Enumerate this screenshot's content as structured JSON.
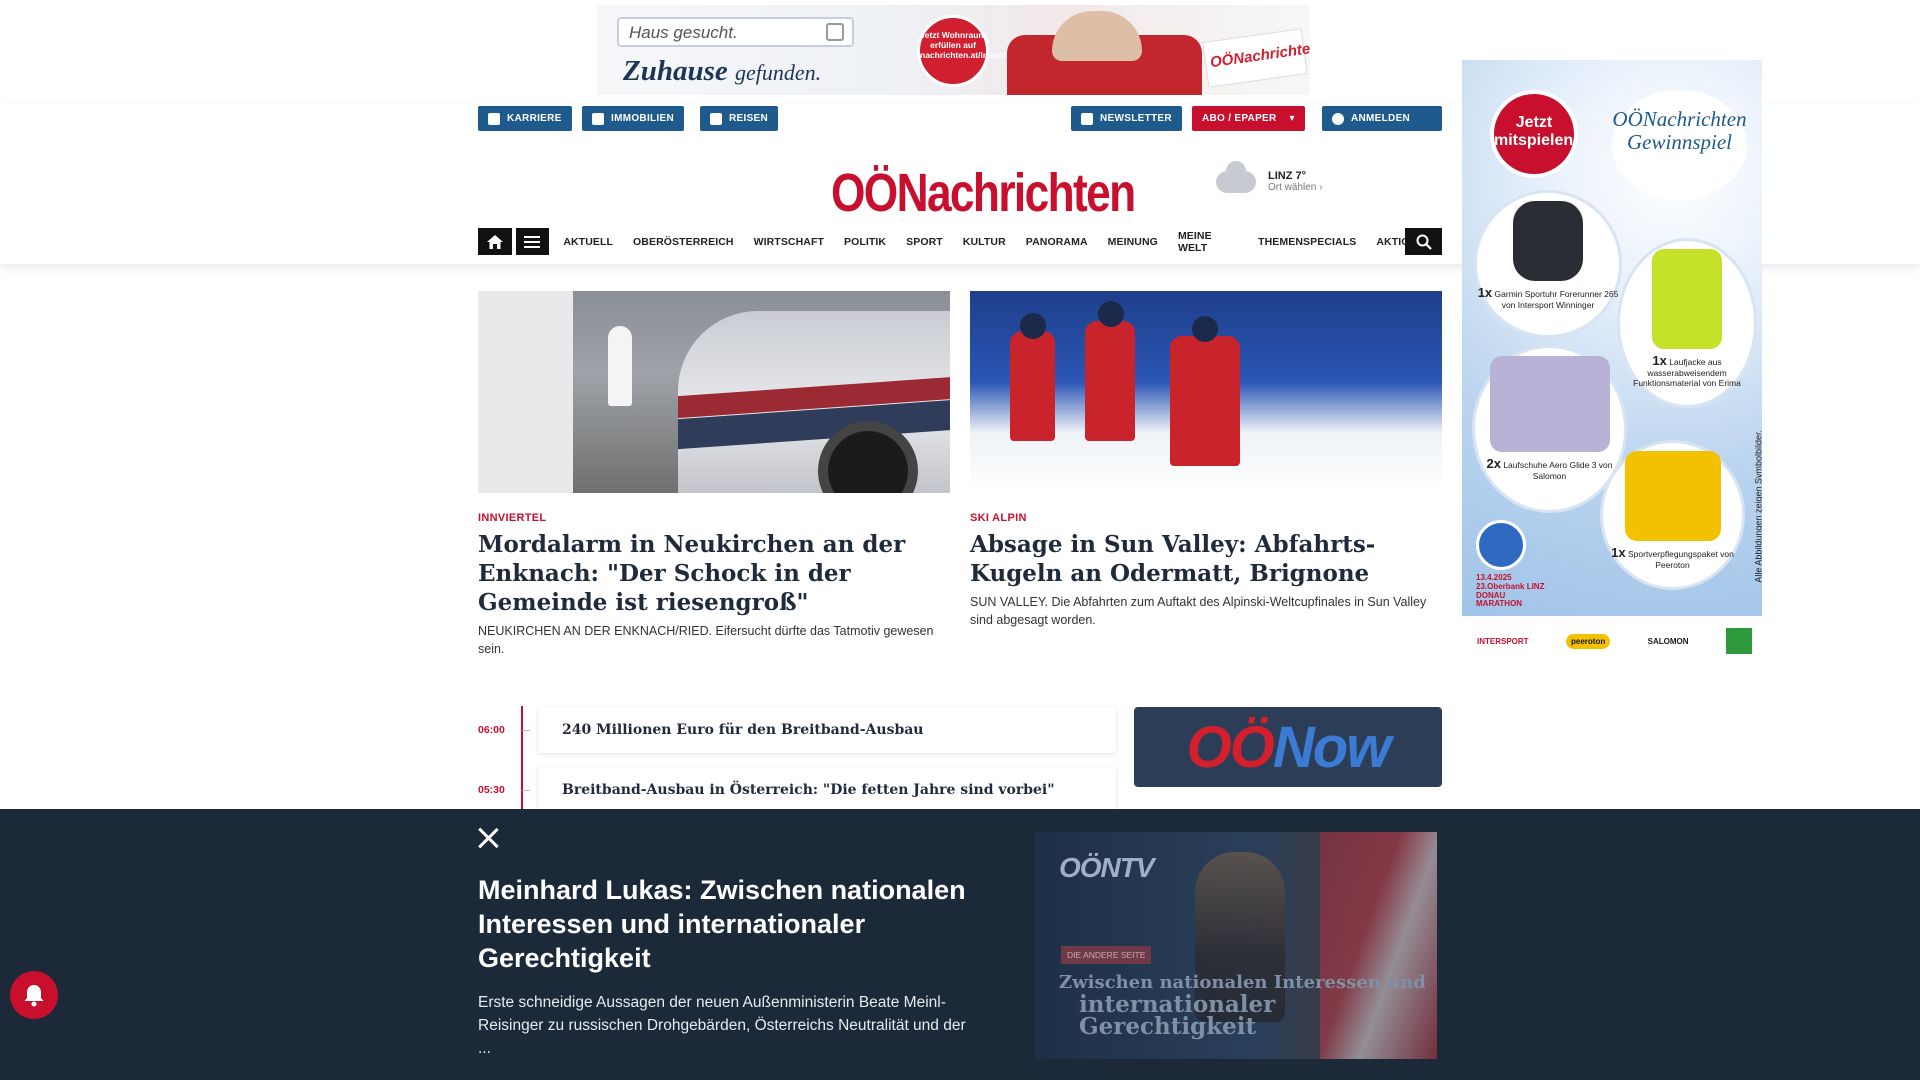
{
  "top_ad": {
    "search_text": "Haus gesucht.",
    "slogan_main": "Zuhause",
    "slogan_rest": "gefunden.",
    "badge": "Jetzt Wohnraum erfüllen auf nachrichten.at/immobilien",
    "paper_logo": "OÖNachrichten"
  },
  "header": {
    "quick_links": [
      {
        "label": "KARRIERE",
        "icon": "briefcase-icon"
      },
      {
        "label": "IMMOBILIEN",
        "icon": "building-icon"
      },
      {
        "label": "REISEN",
        "icon": "plane-icon"
      }
    ],
    "newsletter_label": "NEWSLETTER",
    "abo_label": "ABO / EPAPER",
    "login_label": "ANMELDEN",
    "logo_text": "OÖNachrichten",
    "weather": {
      "city_temp": "LINZ 7°",
      "choose": "Ort wählen"
    }
  },
  "nav": {
    "items": [
      "AKTUELL",
      "OBERÖSTERREICH",
      "WIRTSCHAFT",
      "POLITIK",
      "SPORT",
      "KULTUR",
      "PANORAMA",
      "MEINUNG",
      "MEINE WELT",
      "THEMENSPECIALS",
      "AKTIONEN"
    ]
  },
  "articles": [
    {
      "kicker": "INNVIERTEL",
      "title": "Mordalarm in Neukirchen an der Enknach: \"Der Schock in der Gemeinde ist riesengroß\"",
      "lead": "NEUKIRCHEN AN DER ENKNACH/RIED. Eifersucht dürfte das Tatmotiv gewesen sein."
    },
    {
      "kicker": "SKI ALPIN",
      "title": "Absage in Sun Valley: Abfahrts-Kugeln an Odermatt, Brignone",
      "lead": "SUN VALLEY. Die Abfahrten zum Auftakt des Alpinski-Weltcupfinales in Sun Valley sind abgesagt worden."
    }
  ],
  "ticker": [
    {
      "time": "06:00",
      "title": "240 Millionen Euro für den Breitband-Ausbau"
    },
    {
      "time": "05:30",
      "title": "Breitband-Ausbau in Österreich: \"Die fetten Jahre sind vorbei\""
    }
  ],
  "oenow": {
    "part1": "OÖ",
    "part2": "Now"
  },
  "right_ad": {
    "badge": "Jetzt mitspielen!",
    "title": "OÖNachrichten Gewinnspiel",
    "prizes": [
      {
        "count": "1x",
        "text": "Garmin Sportuhr Forerunner 265 von Intersport Winninger"
      },
      {
        "count": "1x",
        "text": "Laufjacke aus wasserabweisendem Funktionsmaterial von Erima"
      },
      {
        "count": "2x",
        "text": "Laufschuhe Aero Glide 3 von Salomon"
      },
      {
        "count": "1x",
        "text": "Sportverpflegungspaket von Peeroton"
      }
    ],
    "marathon": "13.4.2025 23.Oberbank LINZ DONAU MARATHON",
    "disclaimer": "Alle Abbildungen zeigen Symbolbilder.",
    "sponsors": [
      "INTERSPORT",
      "peeroton",
      "SALOMON"
    ]
  },
  "overlay": {
    "title": "Meinhard Lukas: Zwischen nationalen Interessen und internationaler Gerechtigkeit",
    "lead": "Erste schneidige Aussagen der neuen Außenministerin Beate Meinl-Reisinger zu russischen Drohgebärden, Österreichs Neutralität und der ...",
    "video": {
      "logo": "OÖNTV",
      "tag": "DIE ANDERE SEITE",
      "line1": "Zwischen nationalen Interessen und",
      "line2": "internationaler Gerechtigkeit"
    }
  }
}
